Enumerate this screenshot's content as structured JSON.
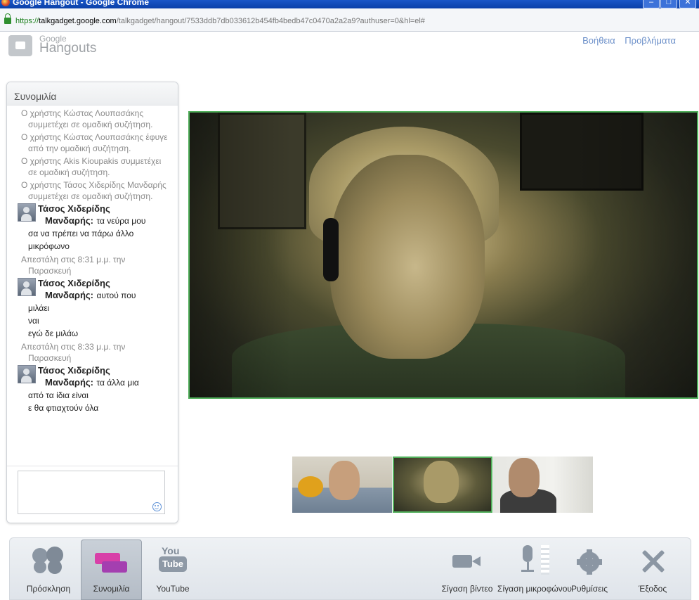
{
  "window": {
    "title": "Google Hangout - Google Chrome",
    "minimize": "‒",
    "maximize": "□",
    "close": "✕"
  },
  "address_bar": {
    "url_scheme": "https://",
    "url_host": "talkgadget.google.com",
    "url_path": "/talkgadget/hangout/7533ddb7db033612b454fb4bedb47c0470a2a2a9?authuser=0&hl=el#"
  },
  "header": {
    "logo_google": "Google",
    "logo_hangouts": "Hangouts",
    "help_link": "Βοήθεια",
    "problems_link": "Προβλήματα"
  },
  "chat": {
    "title": "Συνομιλία",
    "system_messages": [
      "Ο χρήστης Κώστας Λουπασάκης συμμετέχει σε ομαδική συζήτηση.",
      "Ο χρήστης Κώστας Λουπασάκης έφυγε από την ομαδική συζήτηση.",
      "Ο χρήστης Akis Kioupakis συμμετέχει σε ομαδική συζήτηση.",
      "Ο χρήστης Τάσος Χιδερίδης Μανδαρής συμμετέχει σε ομαδική συζήτηση."
    ],
    "messages": [
      {
        "name_line1": "Τάσος Χιδερίδης",
        "name_line2": "Μανδαρής:",
        "first": "τα νεύρα μου",
        "lines": [
          "σα να πρέπει να πάρω άλλο μικρόφωνο"
        ],
        "timestamp": "Απεστάλη στις 8:31 μ.μ. την Παρασκευή"
      },
      {
        "name_line1": "Τάσος Χιδερίδης",
        "name_line2": "Μανδαρής:",
        "first": "αυτού που",
        "lines": [
          "μιλάει",
          "ναι",
          "εγώ δε μιλάω"
        ],
        "timestamp": "Απεστάλη στις 8:33 μ.μ. την Παρασκευή"
      },
      {
        "name_line1": "Τάσος Χιδερίδης",
        "name_line2": "Μανδαρής:",
        "first": "τα άλλα μια",
        "lines": [
          "από τα ίδια είναι",
          "ε θα φτιαχτούν όλα"
        ]
      }
    ],
    "input_value": ""
  },
  "toolbar": {
    "invite": "Πρόσκληση",
    "chat": "Συνομιλία",
    "youtube": "YouTube",
    "youtube_you": "You",
    "youtube_tube": "Tube",
    "mute_video": "Σίγαση βίντεο",
    "mute_mic": "Σίγαση μικροφώνου",
    "settings": "Ρυθμίσεις",
    "exit": "Έξοδος"
  },
  "colors": {
    "active_speaker_border": "#52b05c",
    "link": "#6b8fc9",
    "chat_accent": "#d83fa8"
  }
}
